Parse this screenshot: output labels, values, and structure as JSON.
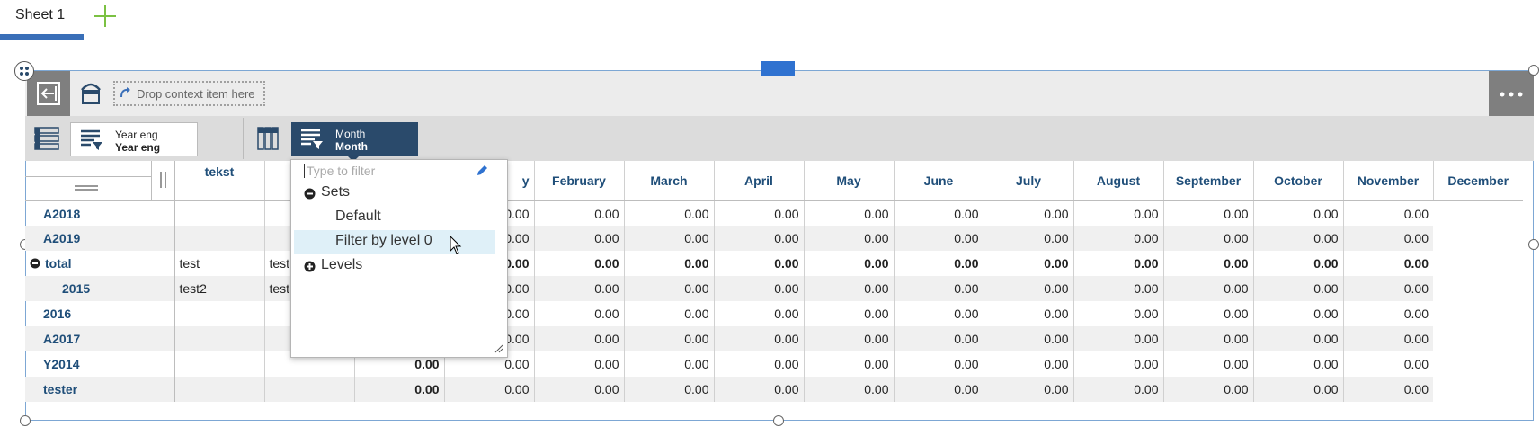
{
  "tabs": [
    {
      "label": "Sheet 1"
    }
  ],
  "widget": {
    "drop_context": "Drop context item here",
    "rows_chip": {
      "line1": "Year eng",
      "line2": "Year eng"
    },
    "cols_chip": {
      "line1": "Month",
      "line2": "Month"
    }
  },
  "grid": {
    "columns": [
      "tekst",
      "",
      "",
      "y",
      "February",
      "March",
      "April",
      "May",
      "June",
      "July",
      "August",
      "September",
      "October",
      "November",
      "December"
    ],
    "rows": [
      {
        "label": "A2018",
        "tekst": "",
        "c2": "",
        "values": [
          "",
          "0.00",
          "0.00",
          "0.00",
          "0.00",
          "0.00",
          "0.00",
          "0.00",
          "0.00",
          "0.00",
          "0.00",
          "0.00"
        ]
      },
      {
        "label": "A2019",
        "tekst": "",
        "c2": "",
        "values": [
          "",
          "0.00",
          "0.00",
          "0.00",
          "0.00",
          "0.00",
          "0.00",
          "0.00",
          "0.00",
          "0.00",
          "0.00",
          "0.00"
        ]
      },
      {
        "label": "total",
        "tekst": "test",
        "c2": "test",
        "values": [
          "",
          "0.00",
          "0.00",
          "0.00",
          "0.00",
          "0.00",
          "0.00",
          "0.00",
          "0.00",
          "0.00",
          "0.00",
          "0.00"
        ]
      },
      {
        "label": "2015",
        "tekst": "test2",
        "c2": "test",
        "values": [
          "",
          "0.00",
          "0.00",
          "0.00",
          "0.00",
          "0.00",
          "0.00",
          "0.00",
          "0.00",
          "0.00",
          "0.00",
          "0.00"
        ]
      },
      {
        "label": "2016",
        "tekst": "",
        "c2": "",
        "values": [
          "",
          "0.00",
          "0.00",
          "0.00",
          "0.00",
          "0.00",
          "0.00",
          "0.00",
          "0.00",
          "0.00",
          "0.00",
          "0.00"
        ]
      },
      {
        "label": "A2017",
        "tekst": "",
        "c2": "",
        "values": [
          "",
          "0.00",
          "0.00",
          "0.00",
          "0.00",
          "0.00",
          "0.00",
          "0.00",
          "0.00",
          "0.00",
          "0.00",
          "0.00"
        ]
      },
      {
        "label": "Y2014",
        "tekst": "",
        "c2": "",
        "values": [
          "0.00",
          "0.00",
          "0.00",
          "0.00",
          "0.00",
          "0.00",
          "0.00",
          "0.00",
          "0.00",
          "0.00",
          "0.00",
          "0.00"
        ]
      },
      {
        "label": "tester",
        "tekst": "",
        "c2": "",
        "values": [
          "0.00",
          "0.00",
          "0.00",
          "0.00",
          "0.00",
          "0.00",
          "0.00",
          "0.00",
          "0.00",
          "0.00",
          "0.00",
          "0.00"
        ]
      }
    ]
  },
  "dropdown": {
    "filter_placeholder": "Type to filter",
    "items": [
      {
        "label": "Sets",
        "kind": "group-expanded"
      },
      {
        "label": "Default",
        "kind": "item"
      },
      {
        "label": "Filter by level 0",
        "kind": "item-hovered"
      },
      {
        "label": "Levels",
        "kind": "group-collapsed"
      }
    ]
  },
  "colors": {
    "accent": "#3a6fb8",
    "header_text": "#1f4e79",
    "chip_dark": "#2a4a6b",
    "add_green": "#5cb85c"
  }
}
